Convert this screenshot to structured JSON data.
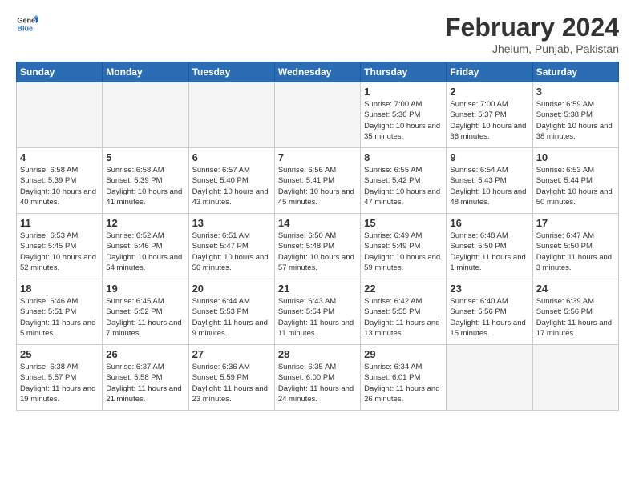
{
  "logo": {
    "line1": "General",
    "line2": "Blue"
  },
  "title": "February 2024",
  "location": "Jhelum, Punjab, Pakistan",
  "days_header": [
    "Sunday",
    "Monday",
    "Tuesday",
    "Wednesday",
    "Thursday",
    "Friday",
    "Saturday"
  ],
  "weeks": [
    [
      {
        "num": "",
        "empty": true
      },
      {
        "num": "",
        "empty": true
      },
      {
        "num": "",
        "empty": true
      },
      {
        "num": "",
        "empty": true
      },
      {
        "num": "1",
        "info": "Sunrise: 7:00 AM\nSunset: 5:36 PM\nDaylight: 10 hours\nand 35 minutes."
      },
      {
        "num": "2",
        "info": "Sunrise: 7:00 AM\nSunset: 5:37 PM\nDaylight: 10 hours\nand 36 minutes."
      },
      {
        "num": "3",
        "info": "Sunrise: 6:59 AM\nSunset: 5:38 PM\nDaylight: 10 hours\nand 38 minutes."
      }
    ],
    [
      {
        "num": "4",
        "info": "Sunrise: 6:58 AM\nSunset: 5:39 PM\nDaylight: 10 hours\nand 40 minutes."
      },
      {
        "num": "5",
        "info": "Sunrise: 6:58 AM\nSunset: 5:39 PM\nDaylight: 10 hours\nand 41 minutes."
      },
      {
        "num": "6",
        "info": "Sunrise: 6:57 AM\nSunset: 5:40 PM\nDaylight: 10 hours\nand 43 minutes."
      },
      {
        "num": "7",
        "info": "Sunrise: 6:56 AM\nSunset: 5:41 PM\nDaylight: 10 hours\nand 45 minutes."
      },
      {
        "num": "8",
        "info": "Sunrise: 6:55 AM\nSunset: 5:42 PM\nDaylight: 10 hours\nand 47 minutes."
      },
      {
        "num": "9",
        "info": "Sunrise: 6:54 AM\nSunset: 5:43 PM\nDaylight: 10 hours\nand 48 minutes."
      },
      {
        "num": "10",
        "info": "Sunrise: 6:53 AM\nSunset: 5:44 PM\nDaylight: 10 hours\nand 50 minutes."
      }
    ],
    [
      {
        "num": "11",
        "info": "Sunrise: 6:53 AM\nSunset: 5:45 PM\nDaylight: 10 hours\nand 52 minutes."
      },
      {
        "num": "12",
        "info": "Sunrise: 6:52 AM\nSunset: 5:46 PM\nDaylight: 10 hours\nand 54 minutes."
      },
      {
        "num": "13",
        "info": "Sunrise: 6:51 AM\nSunset: 5:47 PM\nDaylight: 10 hours\nand 56 minutes."
      },
      {
        "num": "14",
        "info": "Sunrise: 6:50 AM\nSunset: 5:48 PM\nDaylight: 10 hours\nand 57 minutes."
      },
      {
        "num": "15",
        "info": "Sunrise: 6:49 AM\nSunset: 5:49 PM\nDaylight: 10 hours\nand 59 minutes."
      },
      {
        "num": "16",
        "info": "Sunrise: 6:48 AM\nSunset: 5:50 PM\nDaylight: 11 hours\nand 1 minute."
      },
      {
        "num": "17",
        "info": "Sunrise: 6:47 AM\nSunset: 5:50 PM\nDaylight: 11 hours\nand 3 minutes."
      }
    ],
    [
      {
        "num": "18",
        "info": "Sunrise: 6:46 AM\nSunset: 5:51 PM\nDaylight: 11 hours\nand 5 minutes."
      },
      {
        "num": "19",
        "info": "Sunrise: 6:45 AM\nSunset: 5:52 PM\nDaylight: 11 hours\nand 7 minutes."
      },
      {
        "num": "20",
        "info": "Sunrise: 6:44 AM\nSunset: 5:53 PM\nDaylight: 11 hours\nand 9 minutes."
      },
      {
        "num": "21",
        "info": "Sunrise: 6:43 AM\nSunset: 5:54 PM\nDaylight: 11 hours\nand 11 minutes."
      },
      {
        "num": "22",
        "info": "Sunrise: 6:42 AM\nSunset: 5:55 PM\nDaylight: 11 hours\nand 13 minutes."
      },
      {
        "num": "23",
        "info": "Sunrise: 6:40 AM\nSunset: 5:56 PM\nDaylight: 11 hours\nand 15 minutes."
      },
      {
        "num": "24",
        "info": "Sunrise: 6:39 AM\nSunset: 5:56 PM\nDaylight: 11 hours\nand 17 minutes."
      }
    ],
    [
      {
        "num": "25",
        "info": "Sunrise: 6:38 AM\nSunset: 5:57 PM\nDaylight: 11 hours\nand 19 minutes."
      },
      {
        "num": "26",
        "info": "Sunrise: 6:37 AM\nSunset: 5:58 PM\nDaylight: 11 hours\nand 21 minutes."
      },
      {
        "num": "27",
        "info": "Sunrise: 6:36 AM\nSunset: 5:59 PM\nDaylight: 11 hours\nand 23 minutes."
      },
      {
        "num": "28",
        "info": "Sunrise: 6:35 AM\nSunset: 6:00 PM\nDaylight: 11 hours\nand 24 minutes."
      },
      {
        "num": "29",
        "info": "Sunrise: 6:34 AM\nSunset: 6:01 PM\nDaylight: 11 hours\nand 26 minutes."
      },
      {
        "num": "",
        "empty": true
      },
      {
        "num": "",
        "empty": true
      }
    ]
  ]
}
